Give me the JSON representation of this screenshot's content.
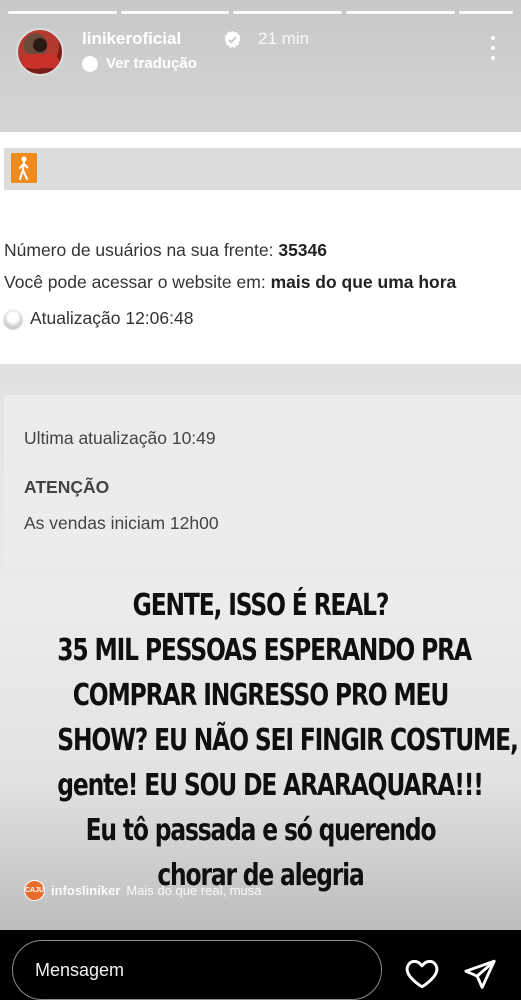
{
  "story": {
    "username": "linikeroficial",
    "time_ago": "21 min",
    "translate_label": "Ver tradução",
    "verified_icon": "verified-badge-icon",
    "menu_icon": "more-vertical-icon",
    "segments": 5
  },
  "queue": {
    "users_label": "Número de usuários na sua frente:",
    "users_value": "35346",
    "access_label": "Você pode acessar o website em:",
    "access_value": "mais do que uma hora",
    "refresh_text": "Atualização 12:06:48"
  },
  "notice": {
    "update_text": "Ultima atualização 10:49",
    "attention": "ATENÇÃO",
    "sales_text": "As vendas iniciam 12h00"
  },
  "caption": {
    "lines": [
      "GENTE, ISSO É REAL?",
      "35 MIL PESSOAS ESPERANDO PRA",
      "COMPRAR INGRESSO PRO MEU",
      "SHOW? EU NÃO SEI FINGIR COSTUME,",
      "gente! EU SOU DE ARARAQUARA!!!",
      "Eu tô passada e só querendo",
      "chorar de alegria"
    ]
  },
  "credit": {
    "avatar_text": "CAJU",
    "handle": "infosliniker",
    "text": "Mais do que real, musa"
  },
  "footer": {
    "message_placeholder": "Mensagem",
    "like_icon": "heart-icon",
    "send_icon": "send-icon"
  },
  "colors": {
    "queue_icon": "#f08c1e",
    "background": "#000000"
  }
}
